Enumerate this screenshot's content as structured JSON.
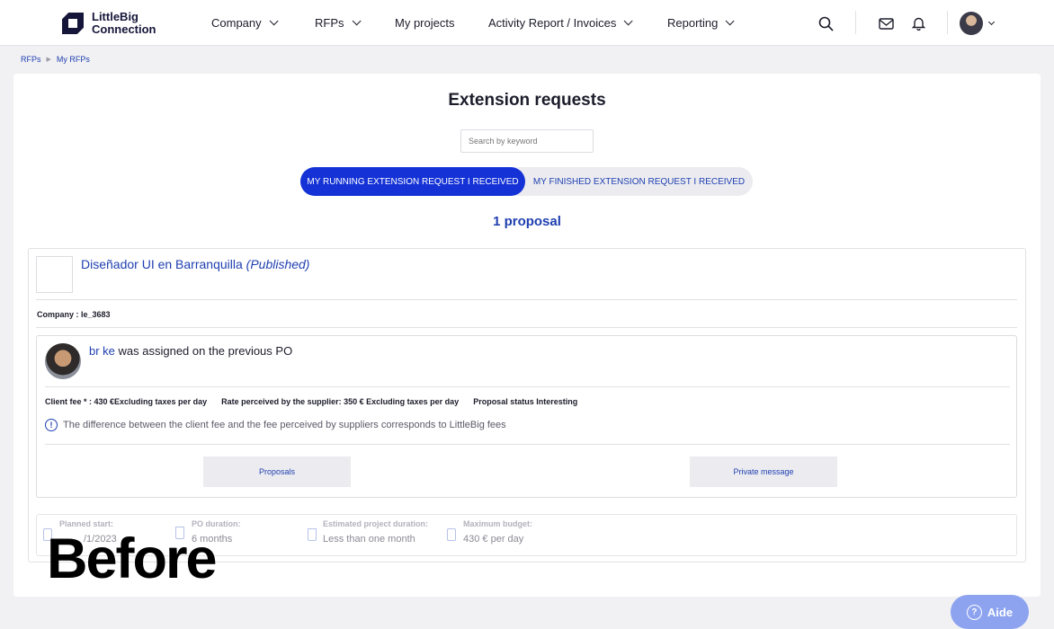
{
  "brand": {
    "name_line1": "LittleBig",
    "name_line2": "Connection"
  },
  "nav": {
    "company": "Company",
    "rfps": "RFPs",
    "my_projects": "My projects",
    "activity": "Activity Report / Invoices",
    "reporting": "Reporting"
  },
  "breadcrumb": {
    "item1": "RFPs",
    "item2": "My RFPs"
  },
  "page": {
    "title": "Extension requests",
    "search_placeholder": "Search by keyword",
    "tab_running": "MY RUNNING EXTENSION REQUEST I RECEIVED",
    "tab_finished": "MY FINISHED EXTENSION REQUEST I RECEIVED",
    "count": "1 proposal"
  },
  "rfp": {
    "title": "Diseñador UI en Barranquilla",
    "status": "(Published)",
    "company_label": "Company : ",
    "company_value": "le_3683"
  },
  "proposal": {
    "person_name": "br ke",
    "assigned_text": " was assigned on the previous PO",
    "client_fee_label": "Client fee * : ",
    "client_fee_value": "430 €Excluding taxes per day",
    "rate_label": "Rate perceived by the supplier: ",
    "rate_value": "350 € Excluding taxes per day",
    "status_label": "Proposal status ",
    "status_value": "Interesting",
    "info_text": "The difference between the client fee and the fee perceived by suppliers corresponds to LittleBig fees",
    "btn_proposals": "Proposals",
    "btn_message": "Private message"
  },
  "details": {
    "start_label": "Planned start:",
    "start_value": "/1/2023",
    "po_label": "PO duration:",
    "po_value": "6 months",
    "est_label": "Estimated project duration:",
    "est_value": "Less than one month",
    "budget_label": "Maximum budget:",
    "budget_value": "430 € per day"
  },
  "overlay": "Before",
  "help": {
    "label": "Aide",
    "icon": "?"
  },
  "colors": {
    "primary": "#1432d6",
    "link": "#1f3fb0",
    "help": "#8da3ef"
  }
}
